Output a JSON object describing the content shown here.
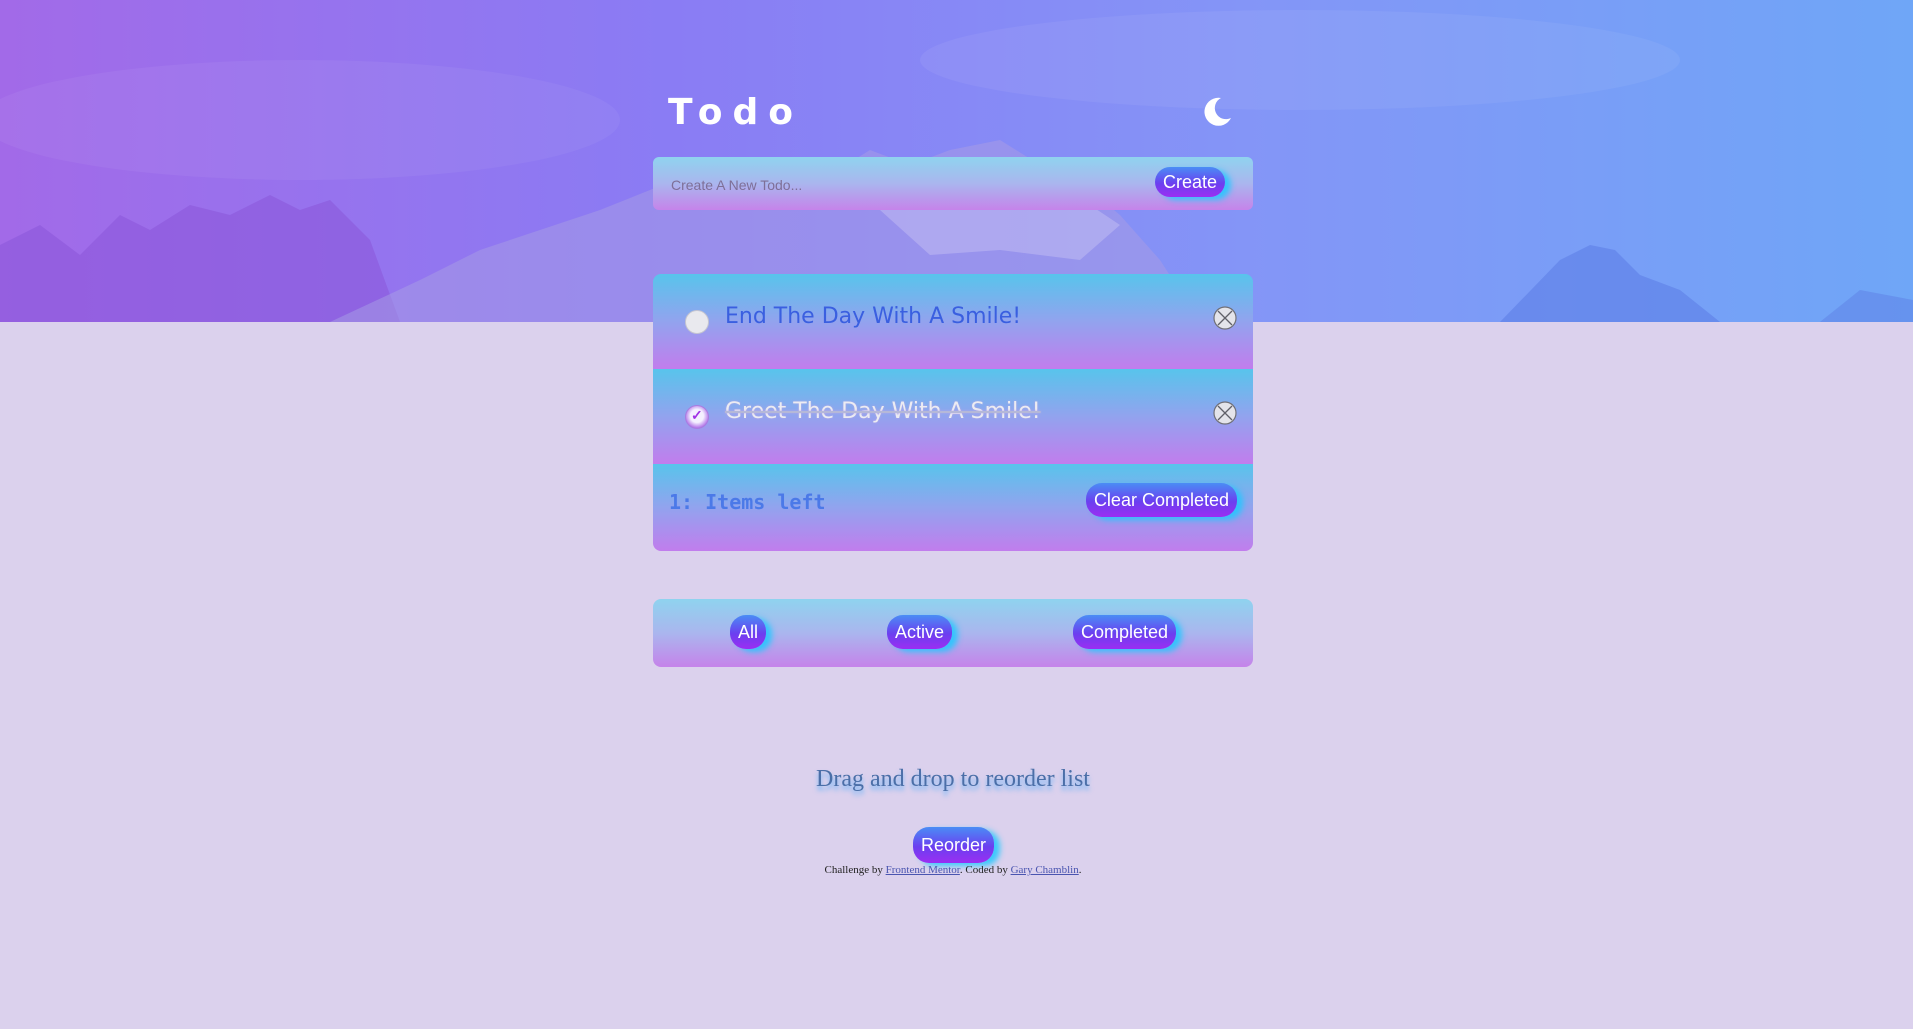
{
  "app": {
    "title": "Todo",
    "theme_icon": "moon-icon"
  },
  "create": {
    "placeholder": "Create A New Todo...",
    "value": "",
    "button_label": "Create"
  },
  "todos": [
    {
      "text": "End The Day With A Smile!",
      "completed": false,
      "delete_icon": "close-circle-icon"
    },
    {
      "text": "Greet The Day With A Smile!",
      "completed": true,
      "delete_icon": "close-circle-icon"
    }
  ],
  "footer": {
    "items_left": "1: Items left",
    "clear_label": "Clear Completed"
  },
  "filters": {
    "all": "All",
    "active": "Active",
    "completed": "Completed"
  },
  "hint": "Drag and drop to reorder list",
  "reorder_label": "Reorder",
  "attribution": {
    "prefix": "Challenge by",
    "link1": "Frontend Mentor",
    "middle": ". Coded by",
    "link2": "Gary Chamblin",
    "suffix": "."
  },
  "colors": {
    "page_bg": "#dbd1ed",
    "hero_left": "#a26ae8",
    "hero_right": "#6fa6f7",
    "button_gradient_top": "#4a8df5",
    "button_gradient_bottom": "#9b2ef2",
    "todo_text": "#3a5fe0"
  }
}
